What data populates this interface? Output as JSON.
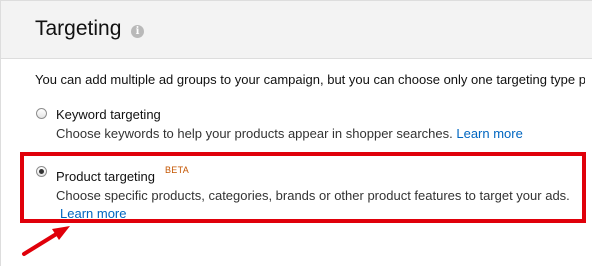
{
  "panel": {
    "title": "Targeting",
    "info_icon": "info-icon",
    "intro": "You can add multiple ad groups to your campaign, but you can choose only one targeting type p"
  },
  "options": [
    {
      "label": "Keyword targeting",
      "selected": false,
      "description": "Choose keywords to help your products appear in shopper searches.",
      "link": "Learn more"
    },
    {
      "label": "Product targeting",
      "badge": "BETA",
      "selected": true,
      "description": "Choose specific products, categories, brands or other product features to target your ads.",
      "link": "Learn more"
    }
  ],
  "annotation": {
    "highlight_color": "#e0000a",
    "icon": "red-arrow-icon"
  },
  "colors": {
    "header_bg": "#f3f3f3",
    "link": "#0066c0",
    "badge": "#c45500"
  }
}
